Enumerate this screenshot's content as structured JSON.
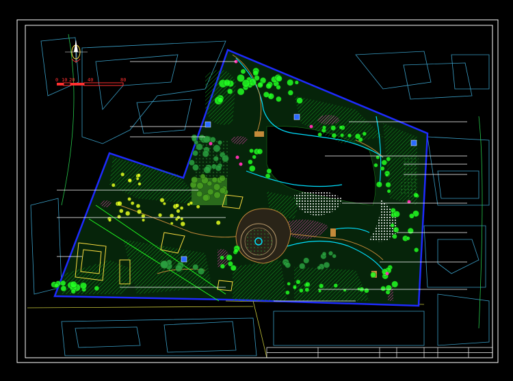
{
  "scale_bar": {
    "ticks": [
      "0",
      "10",
      "20",
      "40",
      "80"
    ]
  },
  "colors": {
    "background": "#000000",
    "frame": "#ffffff",
    "boundary": "#1e2bff",
    "vegetation_dark": "#0a7a12",
    "vegetation_bright": "#22ff22",
    "tree_yellow": "#e8ff20",
    "water": "#00e0ff",
    "path": "#c48a3a",
    "flower": "#ff2fb0",
    "context_buildings": "#3aa0c8",
    "label_leaders": "#ffffff"
  },
  "icons": {
    "north_arrow": "north-arrow-icon",
    "plaza": "circular-plaza-icon"
  },
  "title_block": {
    "cells": [
      "",
      "",
      "",
      "",
      "",
      ""
    ]
  }
}
